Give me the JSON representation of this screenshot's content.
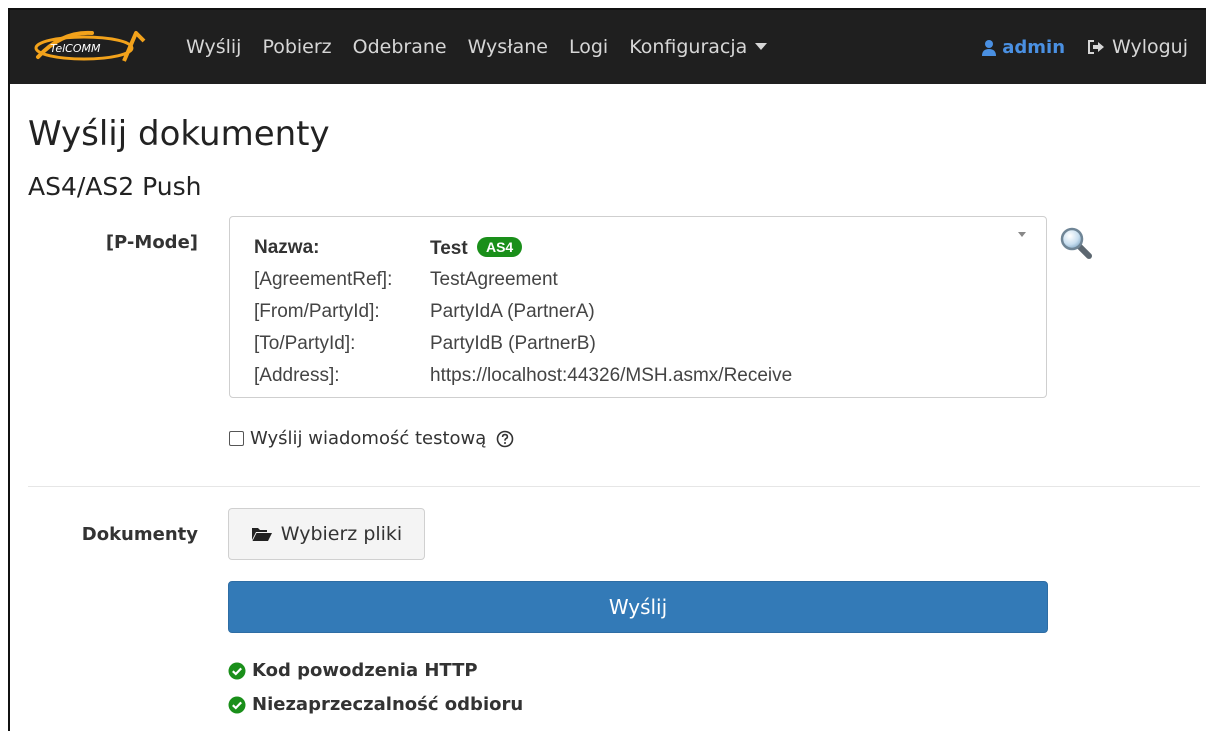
{
  "nav": {
    "logo_text": "TelCOMM",
    "links": [
      "Wyślij",
      "Pobierz",
      "Odebrane",
      "Wysłane",
      "Logi",
      "Konfiguracja"
    ],
    "user": "admin",
    "logout": "Wyloguj"
  },
  "page": {
    "title": "Wyślij dokumenty",
    "subtitle": "AS4/AS2 Push"
  },
  "pmode": {
    "label": "[P-Mode]",
    "rows": [
      {
        "key": "Nazwa:",
        "value": "Test",
        "badge": "AS4"
      },
      {
        "key": "[AgreementRef]:",
        "value": "TestAgreement"
      },
      {
        "key": "[From/PartyId]:",
        "value": "PartyIdA (PartnerA)"
      },
      {
        "key": "[To/PartyId]:",
        "value": "PartyIdB (PartnerB)"
      },
      {
        "key": "[Address]:",
        "value": "https://localhost:44326/MSH.asmx/Receive"
      }
    ]
  },
  "test_message": {
    "label": "Wyślij wiadomość testową",
    "checked": false
  },
  "documents": {
    "label": "Dokumenty",
    "choose_files": "Wybierz pliki"
  },
  "send_button": "Wyślij",
  "statuses": [
    "Kod powodzenia HTTP",
    "Niezaprzeczalność odbioru"
  ],
  "colors": {
    "navbar": "#1f1f1f",
    "primary": "#337ab7",
    "success": "#1a8f1a",
    "user": "#4a90e2"
  }
}
